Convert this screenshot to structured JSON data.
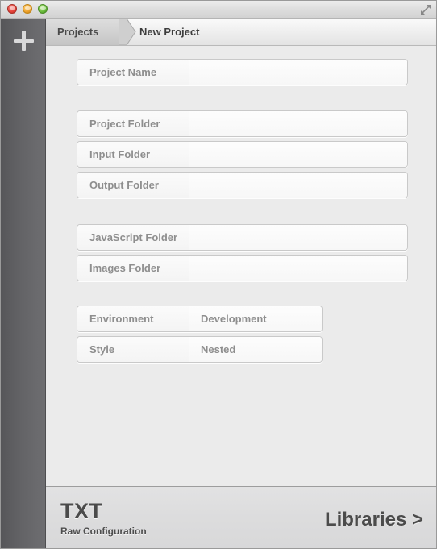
{
  "window": {
    "controls": {
      "close_label": "close",
      "minimize_label": "minimize",
      "maximize_label": "maximize"
    },
    "resize_icon": "resize-diagonal-icon"
  },
  "sidebar": {
    "add_button": {
      "icon": "plus-icon",
      "label": "+"
    }
  },
  "breadcrumb": {
    "active": "Projects",
    "current": "New Project",
    "separator_icon": "chevron-right-icon"
  },
  "form": {
    "groups": [
      {
        "name": "project-name-group",
        "rows": [
          {
            "label": "Project Name",
            "value": "",
            "placeholder": "",
            "width": "wide"
          }
        ]
      },
      {
        "name": "folders-group",
        "rows": [
          {
            "label": "Project Folder",
            "value": "",
            "placeholder": "",
            "width": "wide"
          },
          {
            "label": "Input Folder",
            "value": "",
            "placeholder": "",
            "width": "wide"
          },
          {
            "label": "Output Folder",
            "value": "",
            "placeholder": "",
            "width": "wide"
          }
        ]
      },
      {
        "name": "assets-group",
        "rows": [
          {
            "label": "JavaScript Folder",
            "value": "",
            "placeholder": "",
            "width": "wide"
          },
          {
            "label": "Images Folder",
            "value": "",
            "placeholder": "",
            "width": "wide"
          }
        ]
      },
      {
        "name": "options-group",
        "rows": [
          {
            "label": "Environment",
            "value": "Development",
            "placeholder": "",
            "width": "narrow"
          },
          {
            "label": "Style",
            "value": "Nested",
            "placeholder": "",
            "width": "narrow"
          }
        ]
      }
    ]
  },
  "footer": {
    "title": "TXT",
    "subtitle": "Raw Configuration",
    "action": "Libraries >"
  },
  "colors": {
    "sidebar": "#636366",
    "content_bg": "#ebebeb",
    "footer_bg": "#dcdcdd",
    "label_text": "#8e8e8e",
    "heading_text": "#4b4b4b",
    "close_button": "#e8453c",
    "minimize_button": "#f0a52e",
    "maximize_button": "#6fbf3f"
  }
}
